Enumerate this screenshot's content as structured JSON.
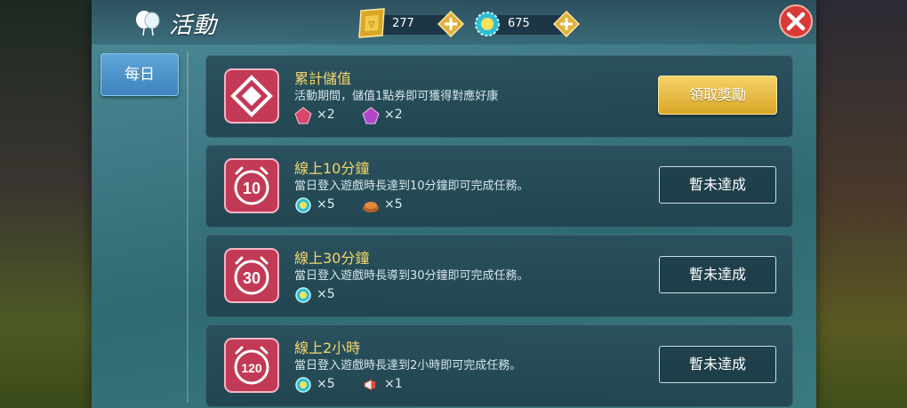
{
  "header": {
    "title": "活動"
  },
  "currencies": [
    {
      "name": "gold-ticket",
      "value": "277"
    },
    {
      "name": "crystal",
      "value": "675"
    }
  ],
  "tabs": [
    {
      "label": "每日"
    }
  ],
  "activities": [
    {
      "title": "累計儲值",
      "desc": "活動期間，儲值1點券即可獲得對應好康",
      "icon": "diamond",
      "badge": "",
      "rewards": [
        {
          "icon": "red-gem",
          "qty": "×2"
        },
        {
          "icon": "purple-gem",
          "qty": "×2"
        }
      ],
      "button": "領取獎勵",
      "button_style": "gold"
    },
    {
      "title": "線上10分鐘",
      "desc": "當日登入遊戲時長達到10分鐘即可完成任務。",
      "icon": "clock",
      "badge": "10",
      "rewards": [
        {
          "icon": "crystal",
          "qty": "×5"
        },
        {
          "icon": "food",
          "qty": "×5"
        }
      ],
      "button": "暫未達成",
      "button_style": "outline"
    },
    {
      "title": "線上30分鐘",
      "desc": "當日登入遊戲時長導到30分鐘即可完成任務。",
      "icon": "clock",
      "badge": "30",
      "rewards": [
        {
          "icon": "crystal",
          "qty": "×5"
        }
      ],
      "button": "暫未達成",
      "button_style": "outline"
    },
    {
      "title": "線上2小時",
      "desc": "當日登入遊戲時長達到2小時即可完成任務。",
      "icon": "clock",
      "badge": "120",
      "rewards": [
        {
          "icon": "crystal",
          "qty": "×5"
        },
        {
          "icon": "megaphone",
          "qty": "×1"
        }
      ],
      "button": "暫未達成",
      "button_style": "outline"
    }
  ],
  "colors": {
    "title_yellow": "#f5d66a",
    "gold_button": "#e6b53a",
    "tab_blue": "#4a93cb"
  }
}
